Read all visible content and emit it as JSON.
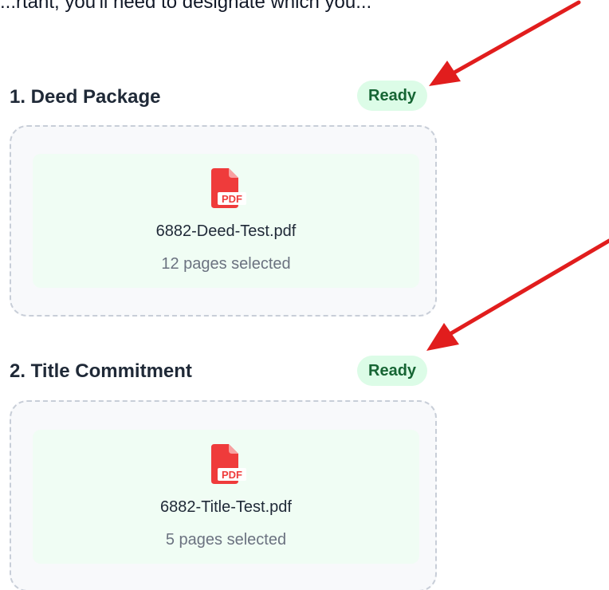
{
  "top_caption": "...rtant, you'll need to designate which you...",
  "sections": [
    {
      "title": "1. Deed Package",
      "status": "Ready",
      "file_name": "6882-Deed-Test.pdf",
      "pages_text": "12 pages selected",
      "file_type_label": "PDF"
    },
    {
      "title": "2. Title Commitment",
      "status": "Ready",
      "file_name": "6882-Title-Test.pdf",
      "pages_text": "5 pages selected",
      "file_type_label": "PDF"
    }
  ],
  "colors": {
    "badge_bg": "#dcfce7",
    "badge_text": "#166534",
    "card_bg": "#f0fdf4",
    "pdf_red": "#ef3b3b",
    "annotation_arrow": "#e11d1d"
  },
  "icons": {
    "file": "pdf-file-icon",
    "annotation": "red-arrow-annotation"
  }
}
